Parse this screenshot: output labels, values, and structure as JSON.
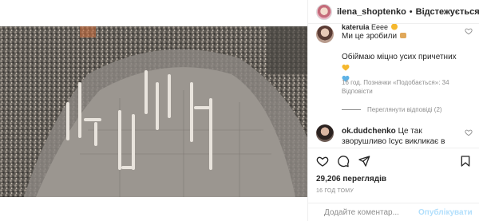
{
  "post": {
    "username": "ilena_shoptenko",
    "separator": "•",
    "follow_label": "Відстежується"
  },
  "comments": [
    {
      "username": "kateruia",
      "username_suffix": "Ееее",
      "text_line1": "Ми це зробили",
      "text_line2": "Обіймаю міцно усих причетних",
      "meta": "16 год.  Позначки «Подобається»: 34  Відповісти",
      "replies_label": "Переглянути відповіді (2)"
    },
    {
      "username": "ok.dudchenko",
      "text": "Це так зворушливо Ісус викликає в мене гордість за"
    }
  ],
  "stats": {
    "views": "29,206 переглядів",
    "time": "16 ГОД ТОМУ"
  },
  "composer": {
    "placeholder": "Додайте коментар...",
    "publish_label": "Опублікувати"
  },
  "icons": {
    "like": "heart-icon",
    "comment": "comment-icon",
    "share": "paper-plane-icon",
    "save": "bookmark-icon",
    "emoji": "smile-icon"
  },
  "colors": {
    "publish_disabled": "#b2dffc",
    "meta_gray": "#8e8e8e",
    "heart_gold": "#f5b82e",
    "heart_blue": "#5fb3e6"
  }
}
